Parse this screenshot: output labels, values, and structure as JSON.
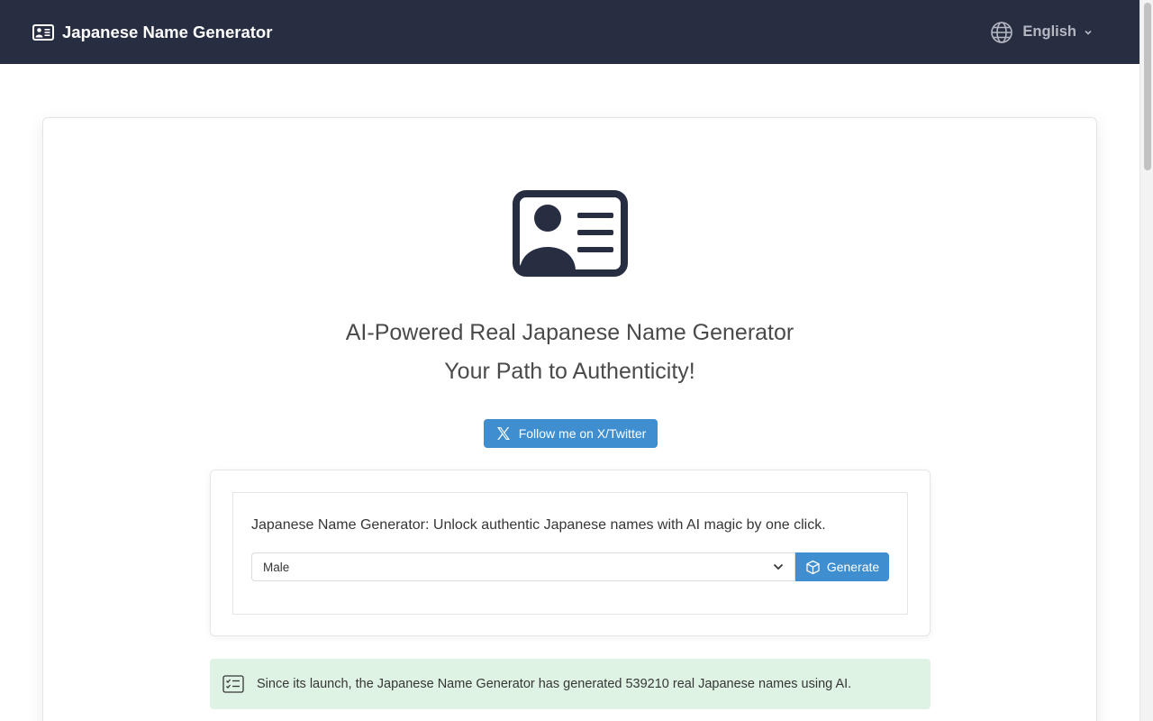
{
  "header": {
    "brand_title": "Japanese Name Generator",
    "brand_icon": "id-card-icon",
    "language": "English",
    "language_icon": "globe-icon"
  },
  "hero": {
    "icon": "id-card-icon",
    "title_line1": "AI-Powered Real Japanese Name Generator",
    "title_line2": "Your Path to Authenticity!"
  },
  "social": {
    "twitter_label": "Follow me on X/Twitter",
    "icon": "x-logo-icon"
  },
  "generator": {
    "description": "Japanese Name Generator: Unlock authentic Japanese names with AI magic by one click.",
    "gender_selected": "Male",
    "generate_label": "Generate",
    "generate_icon": "cube-icon"
  },
  "notice": {
    "text": "Since its launch, the Japanese Name Generator has generated 539210 real Japanese names using AI.",
    "icon": "checklist-icon"
  },
  "colors": {
    "navbar": "#282e42",
    "primary": "#3e8ed0",
    "notice_bg": "#dff3e4",
    "text": "#363636"
  }
}
